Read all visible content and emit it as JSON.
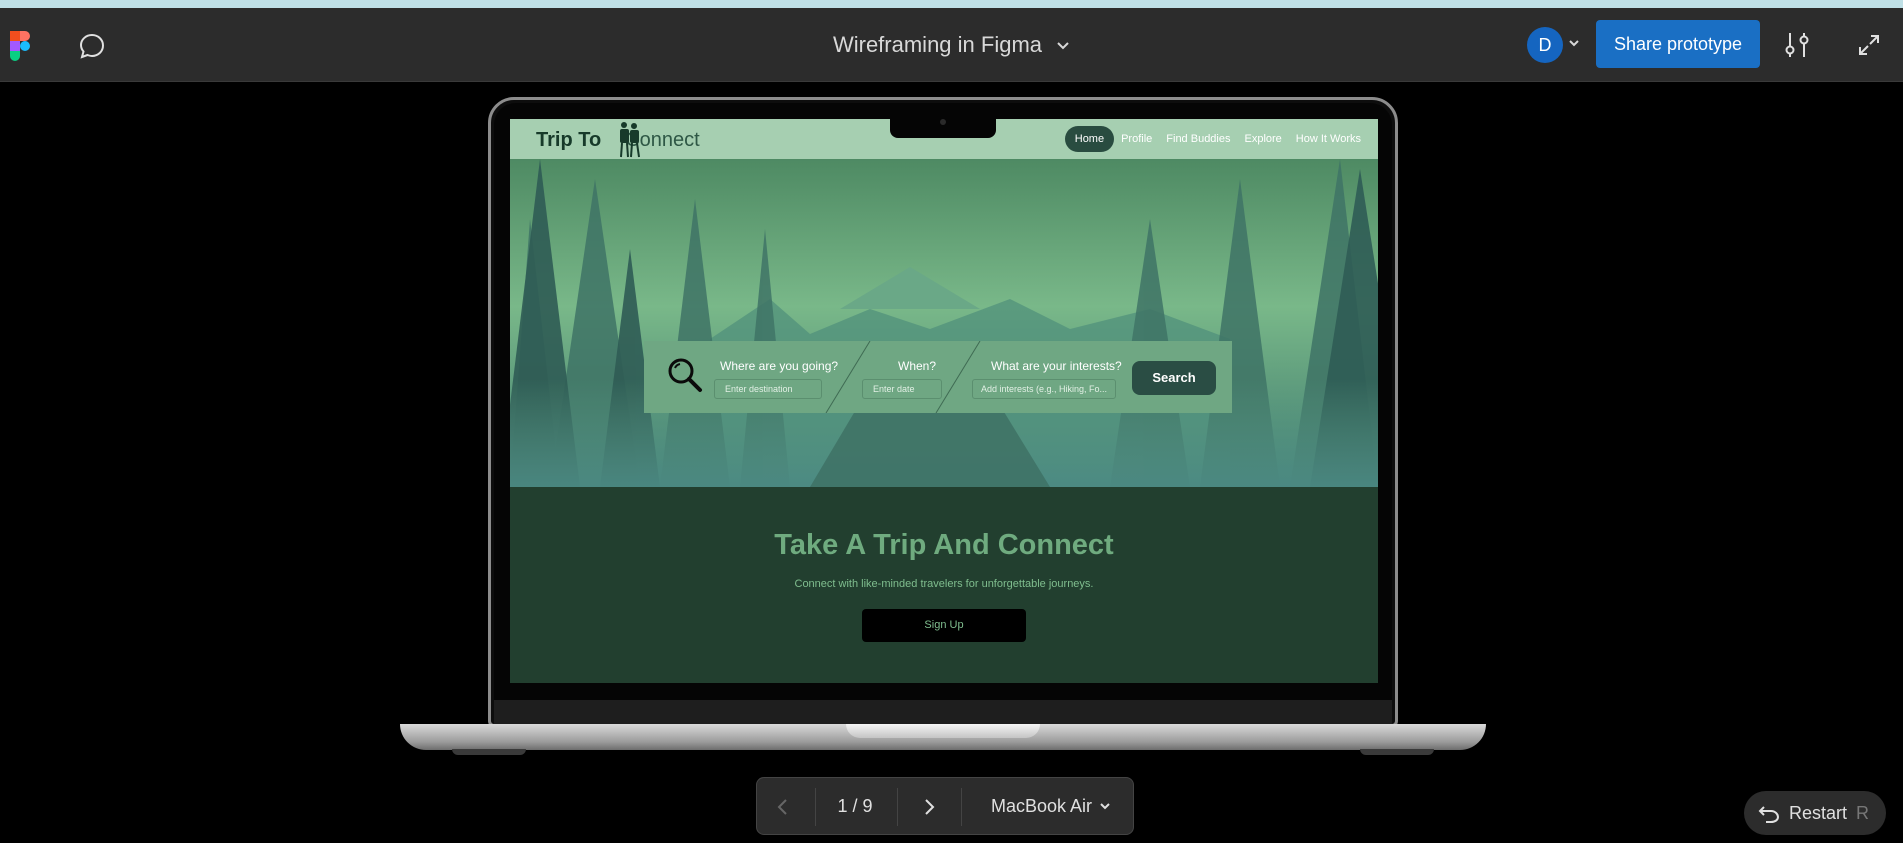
{
  "toolbar": {
    "file_title": "Wireframing in Figma",
    "avatar_initial": "D",
    "share_label": "Share prototype"
  },
  "site": {
    "logo_bold": "Trip To",
    "logo_light": "Connect",
    "nav": [
      "Home",
      "Profile",
      "Find Buddies",
      "Explore",
      "How It Works"
    ],
    "active_nav": "Home",
    "search": {
      "destination_label": "Where are you going?",
      "destination_placeholder": "Enter destination",
      "when_label": "When?",
      "when_placeholder": "Enter date",
      "interests_label": "What are your interests?",
      "interests_placeholder": "Add interests (e.g., Hiking, Fo...",
      "button_label": "Search"
    },
    "headline": "Take A Trip And Connect",
    "subheadline": "Connect with like-minded travelers for unforgettable journeys.",
    "signup_label": "Sign Up"
  },
  "pager": {
    "count": "1 / 9",
    "device": "MacBook Air"
  },
  "restart": {
    "label": "Restart",
    "key": "R"
  },
  "colors": {
    "share_blue": "#1a6fc4",
    "avatar_blue": "#1565c0",
    "nav_green": "#a6cfb1",
    "dark_green": "#223f2f",
    "headline_green": "#6fab7f"
  }
}
